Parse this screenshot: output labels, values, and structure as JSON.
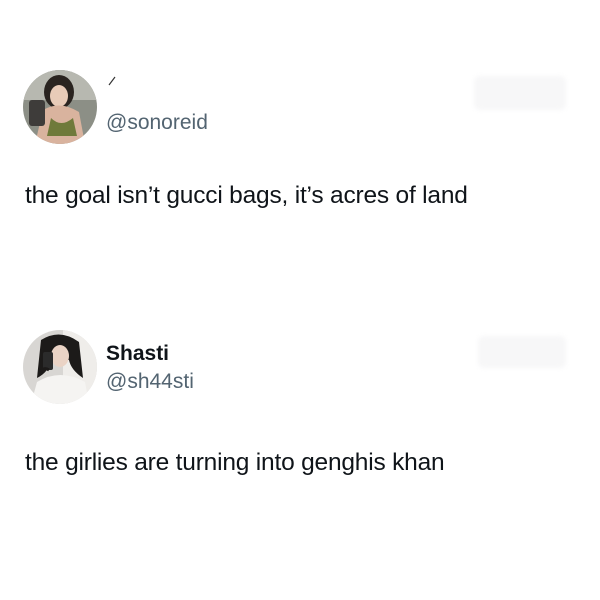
{
  "tweets": [
    {
      "avatar_icon": "profile-photo",
      "display_name": "",
      "handle": "@sonoreid",
      "text": "the goal isn’t gucci bags, it’s acres of land"
    },
    {
      "avatar_icon": "profile-photo",
      "display_name": "Shasti",
      "handle": "@sh44sti",
      "text": "the girlies are turning into genghis khan"
    }
  ],
  "colors": {
    "text_primary": "#0f1419",
    "text_secondary": "#536471",
    "background": "#ffffff"
  }
}
